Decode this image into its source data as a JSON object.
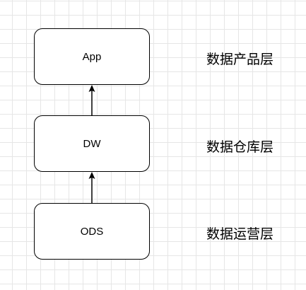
{
  "diagram": {
    "nodes": [
      {
        "id": "app",
        "label": "App"
      },
      {
        "id": "dw",
        "label": "DW"
      },
      {
        "id": "ods",
        "label": "ODS"
      }
    ],
    "edges": [
      {
        "from": "ods",
        "to": "dw"
      },
      {
        "from": "dw",
        "to": "app"
      }
    ],
    "layer_labels": {
      "app": "数据产品层",
      "dw": "数据仓库层",
      "ods": "数据运营层"
    }
  },
  "colors": {
    "stroke": "#000000",
    "grid": "#e6e6e6",
    "background": "#ffffff"
  }
}
